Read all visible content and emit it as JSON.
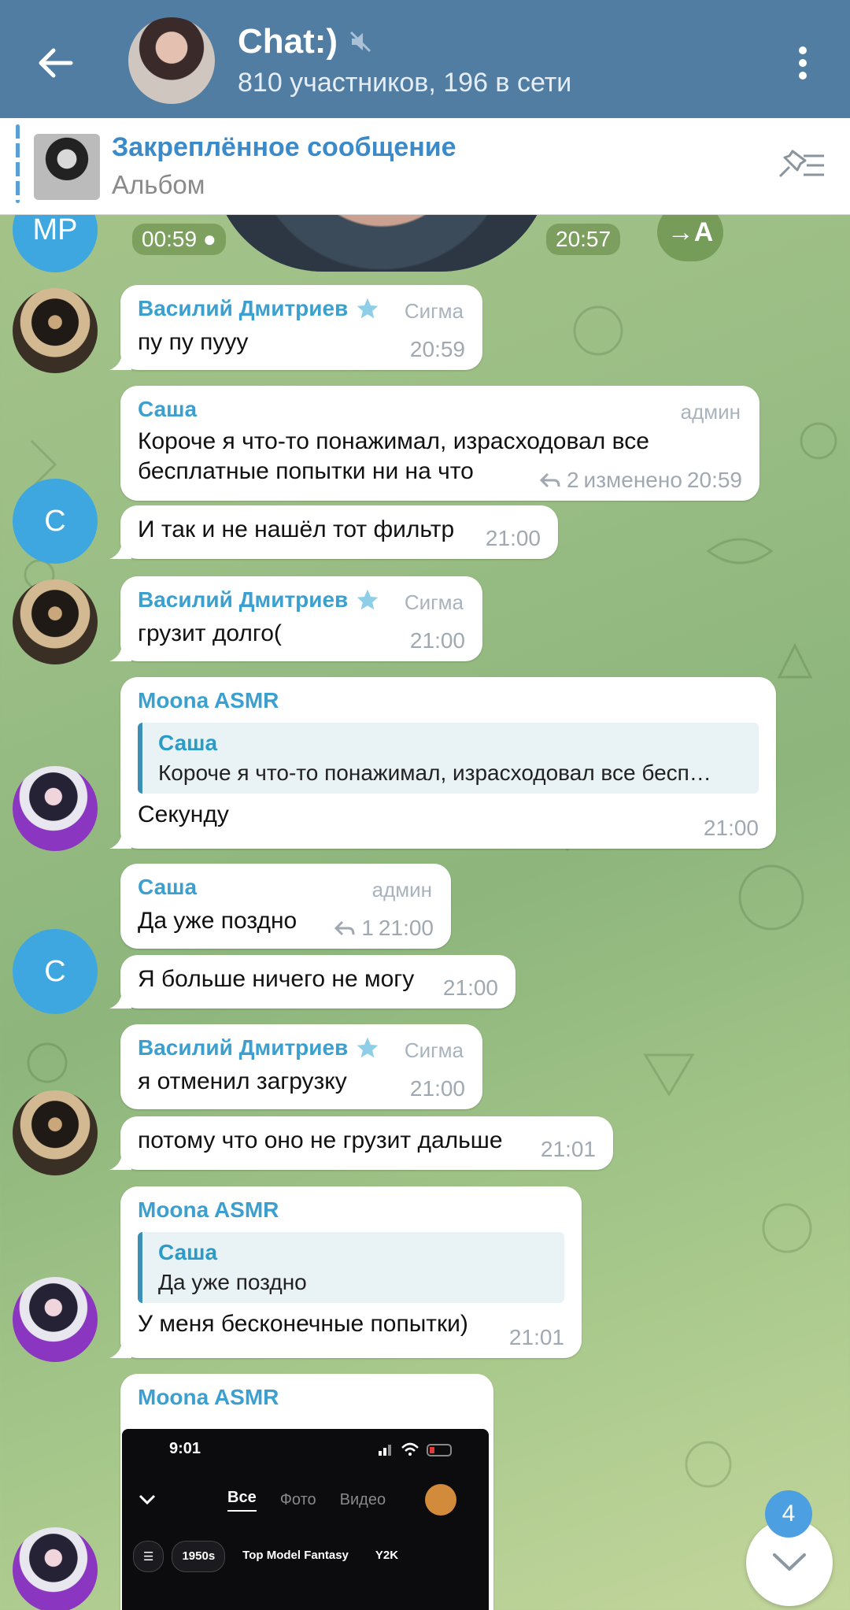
{
  "header": {
    "title": "Chat:)",
    "subtitle": "810 участников, 196 в сети"
  },
  "pinned": {
    "title": "Закреплённое сообщение",
    "subtitle": "Альбом"
  },
  "top_video": {
    "avatar_initials": "MP",
    "duration": "00:59",
    "time": "20:57",
    "share_label": "→A"
  },
  "messages": [
    {
      "sender": "Василий Дмитриев",
      "role": "Сигма",
      "text": "пу пу пууу",
      "time": "20:59"
    },
    {
      "sender": "Саша",
      "role": "админ",
      "text_lines": [
        "Короче я что-то понажимал, израсходовал все",
        "бесплатные попытки ни на что"
      ],
      "replies": "2",
      "edited": "изменено",
      "time": "20:59"
    },
    {
      "text": "И так и не нашёл тот фильтр",
      "time": "21:00",
      "avatar_initial": "С"
    },
    {
      "sender": "Василий Дмитриев",
      "role": "Сигма",
      "text": "грузит долго(",
      "time": "21:00"
    },
    {
      "sender": "Moona ASMR",
      "quote_name": "Саша",
      "quote_text": "Короче я что-то понажимал, израсходовал все бесп…",
      "text": "Секунду",
      "time": "21:00"
    },
    {
      "sender": "Саша",
      "role": "админ",
      "text": "Да уже поздно",
      "replies": "1",
      "time": "21:00"
    },
    {
      "text": "Я больше ничего не могу",
      "time": "21:00",
      "avatar_initial": "С"
    },
    {
      "sender": "Василий Дмитриев",
      "role": "Сигма",
      "text": "я отменил загрузку",
      "time": "21:00"
    },
    {
      "text": "потому что оно не грузит дальше",
      "time": "21:01"
    },
    {
      "sender": "Moona ASMR",
      "quote_name": "Саша",
      "quote_text": "Да уже поздно",
      "text": "У меня бесконечные попытки)",
      "time": "21:01"
    },
    {
      "sender": "Moona ASMR"
    }
  ],
  "screenshot": {
    "time": "9:01",
    "tabs": [
      "Все",
      "Фото",
      "Видео"
    ],
    "chips": [
      "1950s",
      "Top Model Fantasy",
      "Y2K"
    ]
  },
  "scroll": {
    "unread": "4"
  },
  "colors": {
    "header": "#527da3",
    "accent": "#3ba0cf",
    "badge": "#4c9fe0"
  }
}
